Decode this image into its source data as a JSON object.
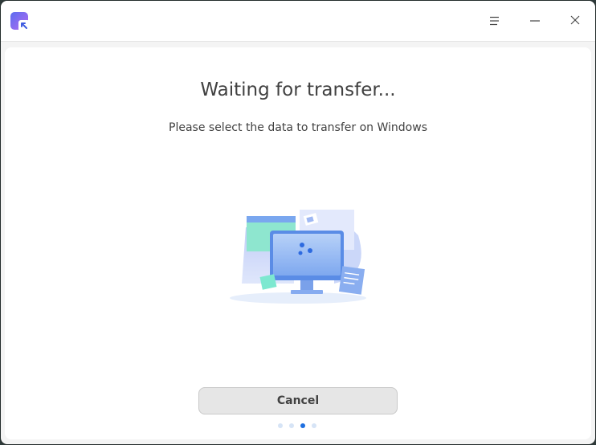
{
  "window": {
    "app_icon": "deepin-data-transfer-icon",
    "buttons": {
      "menu_icon": "menu-icon",
      "minimize_icon": "minimize-icon",
      "close_icon": "close-icon"
    }
  },
  "main": {
    "title": "Waiting for transfer...",
    "subtitle": "Please select the data to transfer on Windows",
    "illustration": "computer-transfer-illustration",
    "cancel_label": "Cancel",
    "pagination": {
      "total": 4,
      "current": 3
    }
  },
  "colors": {
    "accent": "#1e6fe0",
    "dot_inactive": "#d6e4f6",
    "button_bg": "#e6e6e6"
  }
}
